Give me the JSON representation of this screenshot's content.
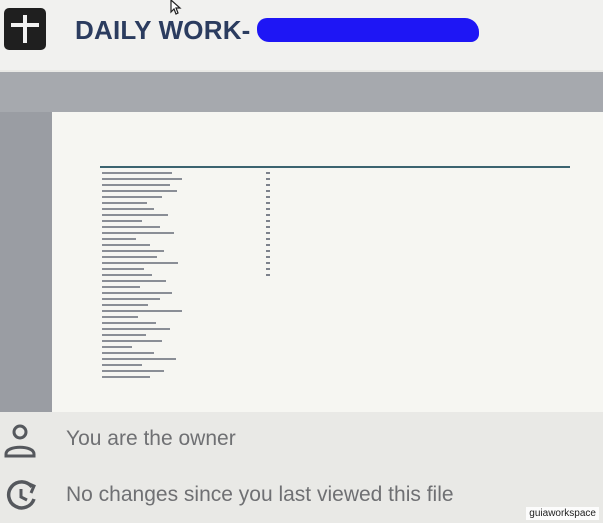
{
  "header": {
    "title": "DAILY WORK-",
    "app_icon": "new-document-icon",
    "redaction_color": "#1e16f5",
    "cursor_icon": "mouse-pointer-icon"
  },
  "preview": {
    "kind": "spreadsheet-thumbnail",
    "header_line_color": "#3c6470"
  },
  "details": {
    "owner_text": "You are the owner",
    "owner_icon": "person-icon",
    "activity_text": "No changes since you last viewed this file",
    "activity_icon": "history-icon"
  },
  "watermark": "guiaworkspace"
}
